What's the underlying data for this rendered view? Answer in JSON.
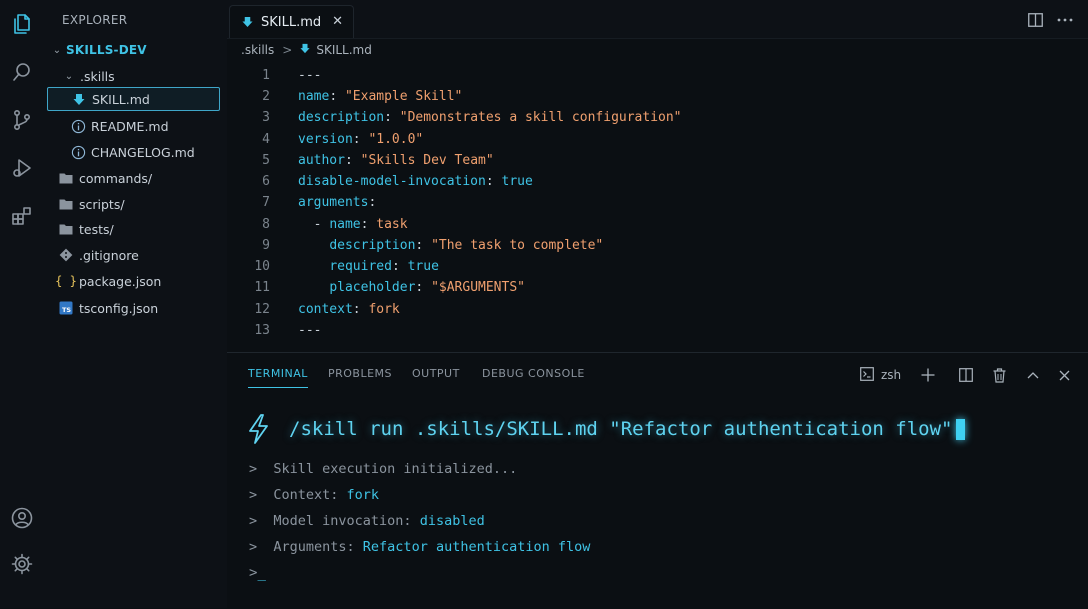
{
  "explorer": {
    "title": "EXPLORER",
    "root": "SKILLS-DEV",
    "items": [
      {
        "label": ".skills",
        "icon": "folder-open"
      },
      {
        "label": "SKILL.md",
        "icon": "markdown-icon"
      },
      {
        "label": "README.md",
        "icon": "info-icon"
      },
      {
        "label": "CHANGELOG.md",
        "icon": "info-icon"
      },
      {
        "label": "commands/",
        "icon": "folder-icon"
      },
      {
        "label": "scripts/",
        "icon": "folder-icon"
      },
      {
        "label": "tests/",
        "icon": "folder-icon"
      },
      {
        "label": ".gitignore",
        "icon": "git-icon"
      },
      {
        "label": "package.json",
        "icon": "json-icon"
      },
      {
        "label": "tsconfig.json",
        "icon": "ts-icon"
      }
    ]
  },
  "tab": {
    "label": "SKILL.md",
    "close": "✕"
  },
  "breadcrumb": {
    "folder": ".skills",
    "sep": ">",
    "file": "SKILL.md"
  },
  "code": {
    "lines": [
      {
        "n": "1",
        "key": "",
        "text": "---"
      },
      {
        "n": "2",
        "key": "name",
        "text": "\"Example Skill\""
      },
      {
        "n": "3",
        "key": "description",
        "text": "\"Demonstrates a skill configuration\""
      },
      {
        "n": "4",
        "key": "version",
        "text": "\"1.0.0\""
      },
      {
        "n": "5",
        "key": "author",
        "text": "\"Skills Dev Team\""
      },
      {
        "n": "6",
        "key": "disable-model-invocation",
        "text": "true"
      },
      {
        "n": "7",
        "key": "arguments",
        "text": ""
      },
      {
        "n": "8",
        "key": "name",
        "text": "task"
      },
      {
        "n": "9",
        "key": "description",
        "text": "\"The task to complete\""
      },
      {
        "n": "10",
        "key": "required",
        "text": "true"
      },
      {
        "n": "11",
        "key": "placeholder",
        "text": "\"$ARGUMENTS\""
      },
      {
        "n": "12",
        "key": "context",
        "text": "fork"
      },
      {
        "n": "13",
        "key": "",
        "text": "---"
      }
    ]
  },
  "panel": {
    "tabs": [
      "TERMINAL",
      "PROBLEMS",
      "OUTPUT",
      "DEBUG CONSOLE"
    ],
    "shell": "zsh",
    "command": "/skill run .skills/SKILL.md \"Refactor authentication flow\"",
    "output": [
      {
        "label": "Skill execution initialized...",
        "value": ""
      },
      {
        "label": "Context: ",
        "value": "fork"
      },
      {
        "label": "Model invocation: ",
        "value": "disabled"
      },
      {
        "label": "Arguments: ",
        "value": "Refactor authentication flow"
      }
    ],
    "prompt_char": ">",
    "prompt_cursor": "_"
  },
  "colors": {
    "accent": "#3fc3e5",
    "string": "#f0a06f",
    "background": "#0b0f13"
  }
}
